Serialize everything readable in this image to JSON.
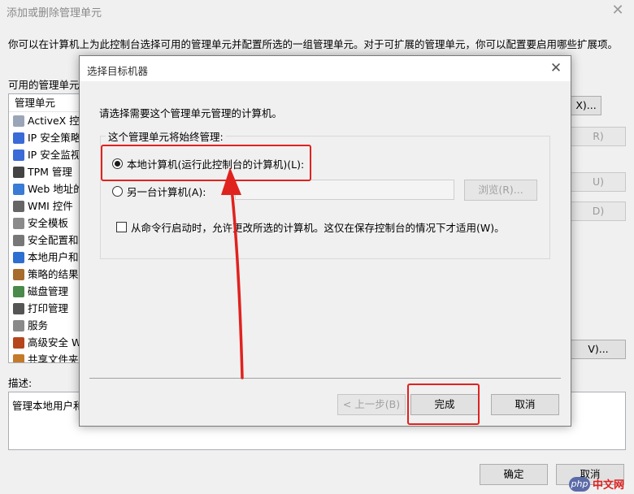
{
  "background": {
    "title": "添加或删除管理单元",
    "intro": "你可以在计算机上为此控制台选择可用的管理单元并配置所选的一组管理单元。对于可扩展的管理单元，你可以配置要启用哪些扩展项。",
    "available_label": "可用的管理单元(",
    "list_header": "管理单元",
    "items": [
      {
        "label": "ActiveX 控件",
        "icon": "activex-icon"
      },
      {
        "label": "IP 安全策略",
        "icon": "ip-policy-icon"
      },
      {
        "label": "IP 安全监视",
        "icon": "ip-monitor-icon"
      },
      {
        "label": "TPM 管理",
        "icon": "tpm-icon"
      },
      {
        "label": "Web 地址的",
        "icon": "web-link-icon"
      },
      {
        "label": "WMI 控件",
        "icon": "wmi-icon"
      },
      {
        "label": "安全模板",
        "icon": "template-icon"
      },
      {
        "label": "安全配置和分",
        "icon": "security-config-icon"
      },
      {
        "label": "本地用户和组",
        "icon": "users-icon"
      },
      {
        "label": "策略的结果集",
        "icon": "policy-icon"
      },
      {
        "label": "磁盘管理",
        "icon": "disk-icon"
      },
      {
        "label": "打印管理",
        "icon": "printer-icon"
      },
      {
        "label": "服务",
        "icon": "services-icon"
      },
      {
        "label": "高级安全 W",
        "icon": "firewall-icon"
      },
      {
        "label": "共享文件夹",
        "icon": "share-folder-icon"
      }
    ],
    "buttons": {
      "edit_ext": "X)...",
      "remove": "R)",
      "move_up": "U)",
      "move_down": "D)",
      "advanced": "V)..."
    },
    "desc_label": "描述:",
    "desc_text": "管理本地用户和",
    "ok": "确定",
    "cancel": "取消"
  },
  "modal": {
    "title": "选择目标机器",
    "prompt": "请选择需要这个管理单元管理的计算机。",
    "group_label": "这个管理单元将始终管理:",
    "local_option": "本地计算机(运行此控制台的计算机)(L):",
    "local_selected": true,
    "other_option": "另一台计算机(A):",
    "other_value": "",
    "browse": "浏览(R)...",
    "checkbox_label": "从命令行启动时，允许更改所选的计算机。这仅在保存控制台的情况下才适用(W)。",
    "checkbox_checked": false,
    "back": "< 上一步(B)",
    "finish": "完成",
    "cancel": "取消"
  },
  "watermark": {
    "logo": "php",
    "text": "中文网"
  },
  "colors": {
    "annotation": "#e0221e"
  }
}
